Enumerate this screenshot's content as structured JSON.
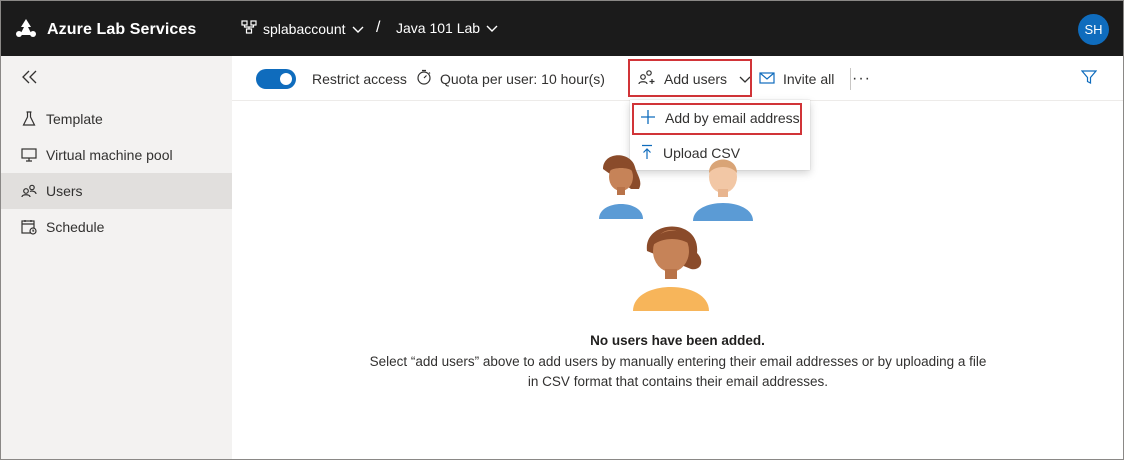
{
  "app": {
    "title": "Azure Lab Services"
  },
  "breadcrumb": {
    "account": "splabaccount",
    "separator": "/",
    "lab": "Java 101 Lab"
  },
  "user": {
    "initials": "SH"
  },
  "sidebar": {
    "items": [
      {
        "label": "Template",
        "icon": "flask-icon"
      },
      {
        "label": "Virtual machine pool",
        "icon": "monitor-icon"
      },
      {
        "label": "Users",
        "icon": "people-icon",
        "active": true
      },
      {
        "label": "Schedule",
        "icon": "calendar-icon"
      }
    ]
  },
  "toolbar": {
    "restrict_access": {
      "label": "Restrict access",
      "on": true
    },
    "quota": "Quota per user: 10 hour(s)",
    "add_users": "Add users",
    "invite_all": "Invite all",
    "more": "···"
  },
  "add_users_menu": {
    "items": [
      {
        "label": "Add by email address",
        "icon": "plus-icon"
      },
      {
        "label": "Upload CSV",
        "icon": "upload-icon"
      }
    ]
  },
  "empty_state": {
    "title": "No users have been added.",
    "description": "Select “add users” above to add users by manually entering their email addresses or by uploading a file in CSV format that contains their email addresses."
  },
  "colors": {
    "topbar": "#1b1b1b",
    "accent": "#0f6cbd",
    "highlight": "#d13438",
    "sidebar": "#f3f2f1"
  }
}
